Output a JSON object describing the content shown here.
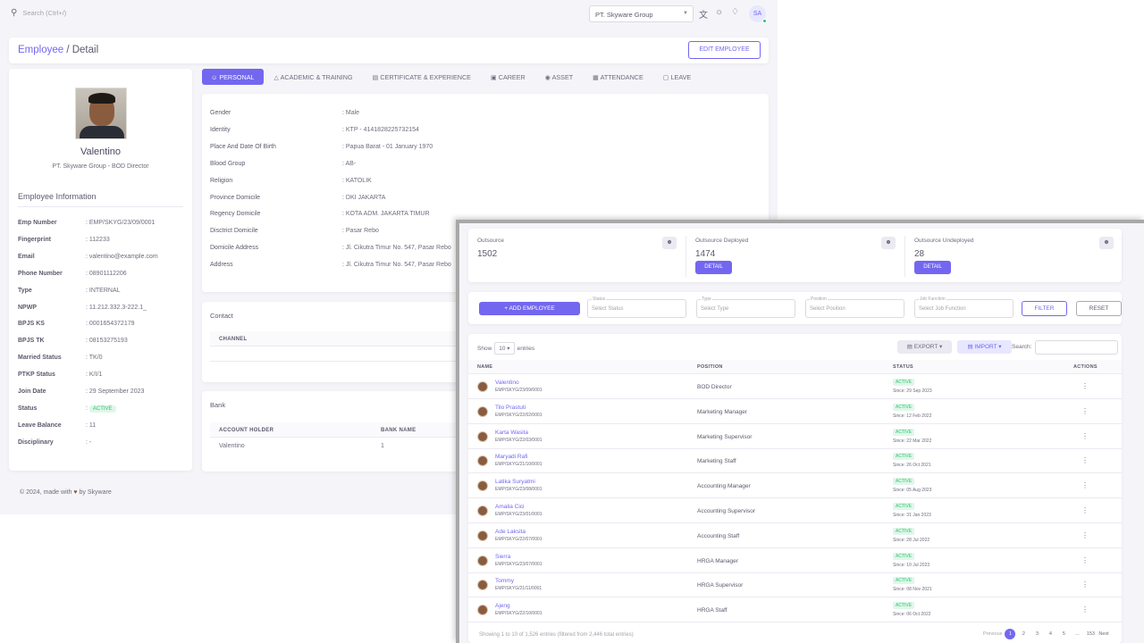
{
  "topbar": {
    "search_placeholder": "Search (Ctrl+/)",
    "company": "PT. Skyware Group",
    "avatar_initials": "SA"
  },
  "header": {
    "breadcrumb_link": "Employee",
    "breadcrumb_sep": " / ",
    "breadcrumb_current": "Detail",
    "edit_button": "EDIT EMPLOYEE"
  },
  "profile": {
    "name": "Valentino",
    "company_position": "PT. Skyware Group - BOD Director",
    "info_title": "Employee Information",
    "fields": [
      {
        "k": "Emp Number",
        "v": ": EMP/SKYG/23/09/0001"
      },
      {
        "k": "Fingerprint",
        "v": ": 112233"
      },
      {
        "k": "Email",
        "v": ": valentino@example.com"
      },
      {
        "k": "Phone Number",
        "v": ": 08901112206"
      },
      {
        "k": "Type",
        "v": ": INTERNAL"
      },
      {
        "k": "NPWP",
        "v": ": 11.212.332.3-222.1_"
      },
      {
        "k": "BPJS KS",
        "v": ": 0001654372179"
      },
      {
        "k": "BPJS TK",
        "v": ": 08153275193"
      },
      {
        "k": "Married Status",
        "v": ": TK/0"
      },
      {
        "k": "PTKP Status",
        "v": ": K/I/1"
      },
      {
        "k": "Join Date",
        "v": ": 29 September 2023"
      },
      {
        "k": "Status",
        "v": ": ",
        "badge": "ACTIVE"
      },
      {
        "k": "Leave Balance",
        "v": ": 11"
      },
      {
        "k": "Disciplinary",
        "v": ": -"
      }
    ]
  },
  "tabs": [
    "PERSONAL",
    "ACADEMIC & TRAINING",
    "CERTIFICATE & EXPERIENCE",
    "CAREER",
    "ASSET",
    "ATTENDANCE",
    "LEAVE"
  ],
  "personal": [
    {
      "k": "Gender",
      "v": ": Male"
    },
    {
      "k": "Identity",
      "v": ": KTP - 4141828225732154"
    },
    {
      "k": "Place And Date Of Birth",
      "v": ": Papua Barat - 01 January 1970"
    },
    {
      "k": "Blood Group",
      "v": ": AB-"
    },
    {
      "k": "Religion",
      "v": ": KATOLIK"
    },
    {
      "k": "Province Domicile",
      "v": ": DKI JAKARTA"
    },
    {
      "k": "Regency Domicile",
      "v": ": KOTA ADM. JAKARTA TIMUR"
    },
    {
      "k": "Disctrict Domicile",
      "v": ": Pasar Rebo"
    },
    {
      "k": "Domicile Address",
      "v": ": Jl. Cikutra Timur No. 547, Pasar Rebo"
    },
    {
      "k": "Address",
      "v": ": Jl. Cikutra Timur No. 547, Pasar Rebo"
    }
  ],
  "contact": {
    "title": "Contact",
    "col_channel": "CHANNEL"
  },
  "bank": {
    "title": "Bank",
    "col_holder": "ACCOUNT HOLDER",
    "col_bank": "BANK NAME",
    "holder": "Valentino",
    "bank_name": "1"
  },
  "footer": {
    "prefix": "© 2024, made with",
    "suffix": "by Skyware"
  },
  "overlay": {
    "stats": [
      {
        "label": "Outsource",
        "value": "1502"
      },
      {
        "label": "Outsource Deployed",
        "value": "1474",
        "button": "DETAIL"
      },
      {
        "label": "Outsource Undeployed",
        "value": "28",
        "button": "DETAIL"
      }
    ],
    "add_button": "+ ADD EMPLOYEE",
    "filters": [
      {
        "label": "Status",
        "placeholder": "Select Status"
      },
      {
        "label": "Type",
        "placeholder": "Select Type"
      },
      {
        "label": "Position",
        "placeholder": "Select Position"
      },
      {
        "label": "Job Function",
        "placeholder": "Select Job Function"
      }
    ],
    "filter_button": "FILTER",
    "reset_button": "RESET",
    "show_label": "Show",
    "show_value": "10",
    "entries_label": "entries",
    "export_button": "EXPORT",
    "import_button": "IMPORT",
    "search_label": "Search:",
    "columns": [
      "NAME",
      "POSITION",
      "STATUS",
      "ACTIONS"
    ],
    "rows": [
      {
        "name": "Valentino",
        "id": "EMP/SKYG/23/09/0001",
        "position": "BOD Director",
        "status": "ACTIVE",
        "since": "Since: 29 Sep 2023"
      },
      {
        "name": "Tilo Prastuti",
        "id": "EMP/SKYG/22/02/0001",
        "position": "Marketing Manager",
        "status": "ACTIVE",
        "since": "Since: 12 Feb 2022"
      },
      {
        "name": "Karta Wasita",
        "id": "EMP/SKYG/22/03/0001",
        "position": "Marketing Supervisor",
        "status": "ACTIVE",
        "since": "Since: 22 Mar 2022"
      },
      {
        "name": "Maryadi Rafi",
        "id": "EMP/SKYG/21/10/0001",
        "position": "Marketing Staff",
        "status": "ACTIVE",
        "since": "Since: 26 Oct 2021"
      },
      {
        "name": "Latika Suryatmi",
        "id": "EMP/SKYG/23/08/0001",
        "position": "Accounting Manager",
        "status": "ACTIVE",
        "since": "Since: 05 Aug 2023"
      },
      {
        "name": "Amalia Cici",
        "id": "EMP/SKYG/23/01/0001",
        "position": "Accounting Supervisor",
        "status": "ACTIVE",
        "since": "Since: 31 Jan 2023"
      },
      {
        "name": "Ade Laksita",
        "id": "EMP/SKYG/22/07/0001",
        "position": "Accounting Staff",
        "status": "ACTIVE",
        "since": "Since: 28 Jul 2022"
      },
      {
        "name": "Sierra",
        "id": "EMP/SKYG/23/07/0001",
        "position": "HRGA Manager",
        "status": "ACTIVE",
        "since": "Since: 10 Jul 2023"
      },
      {
        "name": "Tommy",
        "id": "EMP/SKYG/21/11/0001",
        "position": "HRGA Supervisor",
        "status": "ACTIVE",
        "since": "Since: 08 Nov 2021"
      },
      {
        "name": "Ajeng",
        "id": "EMP/SKYG/22/10/0001",
        "position": "HRGA Staff",
        "status": "ACTIVE",
        "since": "Since: 06 Oct 2022"
      }
    ],
    "table_info": "Showing 1 to 10 of 1,526 entries (filtered from 2,446 total entries)",
    "pager": {
      "prev": "Previous",
      "pages": [
        "1",
        "2",
        "3",
        "4",
        "5",
        "...",
        "153"
      ],
      "next": "Next"
    }
  }
}
